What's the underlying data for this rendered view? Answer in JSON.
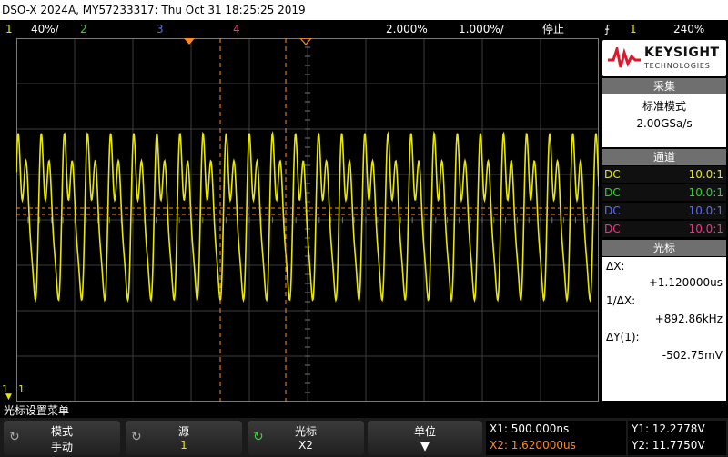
{
  "title": "DSO-X 2024A, MY57233317: Thu Oct 31 18:25:25 2019",
  "status": {
    "ch1_num": "1",
    "ch1_scale": "40%/",
    "ch2_num": "2",
    "ch3_num": "3",
    "ch4_num": "4",
    "delay": "2.000%",
    "timebase": "1.000%/",
    "run_state": "停止",
    "trig_icon": "trigger-edge-icon",
    "trig_ch": "1",
    "trig_level": "240%"
  },
  "grid": {
    "ch1_marker": "1",
    "trig_marker": "T"
  },
  "brand": {
    "name": "KEYSIGHT",
    "sub": "TECHNOLOGIES"
  },
  "acquire": {
    "header": "采集",
    "mode": "标准模式",
    "rate": "2.00GSa/s"
  },
  "channels": {
    "header": "通道",
    "rows": [
      {
        "coupling": "DC",
        "ratio": "10.0:1",
        "color": "#e8e800"
      },
      {
        "coupling": "DC",
        "ratio": "10.0:1",
        "color": "#22dd22"
      },
      {
        "coupling": "DC",
        "ratio": "10.0:1",
        "color": "#5a6bff"
      },
      {
        "coupling": "DC",
        "ratio": "10.0:1",
        "color": "#ff2d8a"
      }
    ]
  },
  "cursors": {
    "header": "光标",
    "dx_label": "ΔX:",
    "dx_value": "+1.120000us",
    "inv_label": "1/ΔX:",
    "inv_value": "+892.86kHz",
    "dy_label": "ΔY(1):",
    "dy_value": "-502.75mV"
  },
  "menu": {
    "title": "光标设置菜单",
    "keys": [
      {
        "label": "模式",
        "value": "手动",
        "icon": "rotate-knob-icon"
      },
      {
        "label": "源",
        "value": "1",
        "icon": "rotate-knob-icon"
      },
      {
        "label": "光标",
        "value": "X2",
        "icon": "rotate-knob-icon"
      },
      {
        "label": "单位",
        "value": "",
        "icon": "down-arrow-icon"
      }
    ]
  },
  "readout": {
    "x1": "X1: 500.000ns",
    "x2": "X2: 1.620000us",
    "y1": "Y1: 12.2778V",
    "y2": "Y2: 11.7750V"
  },
  "colors": {
    "ch1": "#e8e800",
    "ch2": "#22dd22",
    "ch3": "#5a6bff",
    "ch4": "#ff2d8a",
    "cursor": "#ff8a1f",
    "grid": "#3c3c3c",
    "brand_red": "#e0162b"
  },
  "waveform": {
    "signal": "periodic multi-tone trace (ch1)",
    "x_cursor_positions_ns": [
      500,
      1620
    ],
    "y_cursor_values_V": [
      12.2778,
      11.775
    ]
  }
}
